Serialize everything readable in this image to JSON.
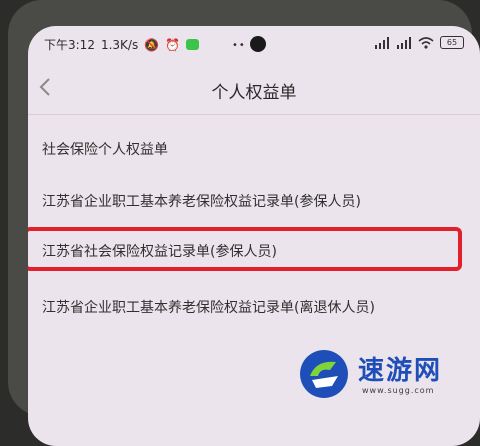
{
  "status": {
    "time": "下午3:12",
    "speed": "1.3K/s",
    "battery": "65"
  },
  "navbar": {
    "title": "个人权益单"
  },
  "list": {
    "items": [
      "社会保险个人权益单",
      "江苏省企业职工基本养老保险权益记录单(参保人员)",
      "江苏省社会保险权益记录单(参保人员)",
      "江苏省企业职工基本养老保险权益记录单(离退休人员)"
    ]
  },
  "watermark": {
    "text": "速游网",
    "url": "www.sugg.com"
  },
  "colors": {
    "highlight": "#e0202a",
    "screen_bg": "#ece4ec",
    "watermark_blue": "#1e4fb8"
  }
}
